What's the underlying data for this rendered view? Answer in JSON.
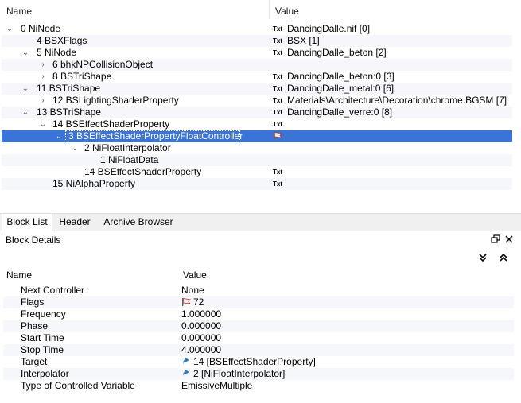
{
  "block_list": {
    "columns": {
      "name": "Name",
      "value": "Value"
    },
    "txt_badge": "Txt",
    "rows": [
      {
        "arrow": "v",
        "name": "0 NiNode",
        "badge": true,
        "value": "DancingDalle.nif [0]"
      },
      {
        "arrow": "",
        "name": "4 BSXFlags",
        "badge": true,
        "value": "BSX [1]"
      },
      {
        "arrow": "v",
        "name": "5 NiNode",
        "badge": true,
        "value": "DancingDalle_beton [2]"
      },
      {
        "arrow": ">",
        "name": "6 bhkNPCollisionObject",
        "badge": false,
        "value": ""
      },
      {
        "arrow": ">",
        "name": "8 BSTriShape",
        "badge": true,
        "value": "DancingDalle_beton:0 [3]"
      },
      {
        "arrow": "v",
        "name": "11 BSTriShape",
        "badge": true,
        "value": "DancingDalle_metal:0 [6]"
      },
      {
        "arrow": ">",
        "name": "12 BSLightingShaderProperty",
        "badge": true,
        "value": "Materials\\Architecture\\Decoration\\chrome.BGSM [7]"
      },
      {
        "arrow": "v",
        "name": "13 BSTriShape",
        "badge": true,
        "value": "DancingDalle_verre:0 [8]"
      },
      {
        "arrow": "v",
        "name": "14 BSEffectShaderProperty",
        "badge": true,
        "value": ""
      },
      {
        "arrow": "v",
        "name": "3 BSEffectShaderPropertyFloatController",
        "badge": false,
        "value": ""
      },
      {
        "arrow": "v",
        "name": "2 NiFloatInterpolator",
        "badge": false,
        "value": ""
      },
      {
        "arrow": "",
        "name": "1 NiFloatData",
        "badge": false,
        "value": ""
      },
      {
        "arrow": "",
        "name": "14 BSEffectShaderProperty",
        "badge": true,
        "value": ""
      },
      {
        "arrow": "",
        "name": "15 NiAlphaProperty",
        "badge": true,
        "value": ""
      }
    ]
  },
  "tabs": [
    "Block List",
    "Header",
    "Archive Browser"
  ],
  "details": {
    "title": "Block Details",
    "columns": {
      "name": "Name",
      "value": "Value"
    },
    "rows": [
      {
        "name": "Next Controller",
        "value": "None",
        "icon": ""
      },
      {
        "name": "Flags",
        "value": "72",
        "icon": "flag-icon"
      },
      {
        "name": "Frequency",
        "value": "1.000000",
        "icon": ""
      },
      {
        "name": "Phase",
        "value": "0.000000",
        "icon": ""
      },
      {
        "name": "Start Time",
        "value": "0.000000",
        "icon": ""
      },
      {
        "name": "Stop Time",
        "value": "4.000000",
        "icon": ""
      },
      {
        "name": "Target",
        "value": "14 [BSEffectShaderProperty]",
        "icon": "link-icon"
      },
      {
        "name": "Interpolator",
        "value": "2 [NiFloatInterpolator]",
        "icon": "link-icon"
      },
      {
        "name": "Type of Controlled Variable",
        "value": "EmissiveMultiple",
        "icon": ""
      }
    ]
  },
  "colors": {
    "selection": "#3b74d6",
    "alt_row": "#f6f7fb"
  }
}
